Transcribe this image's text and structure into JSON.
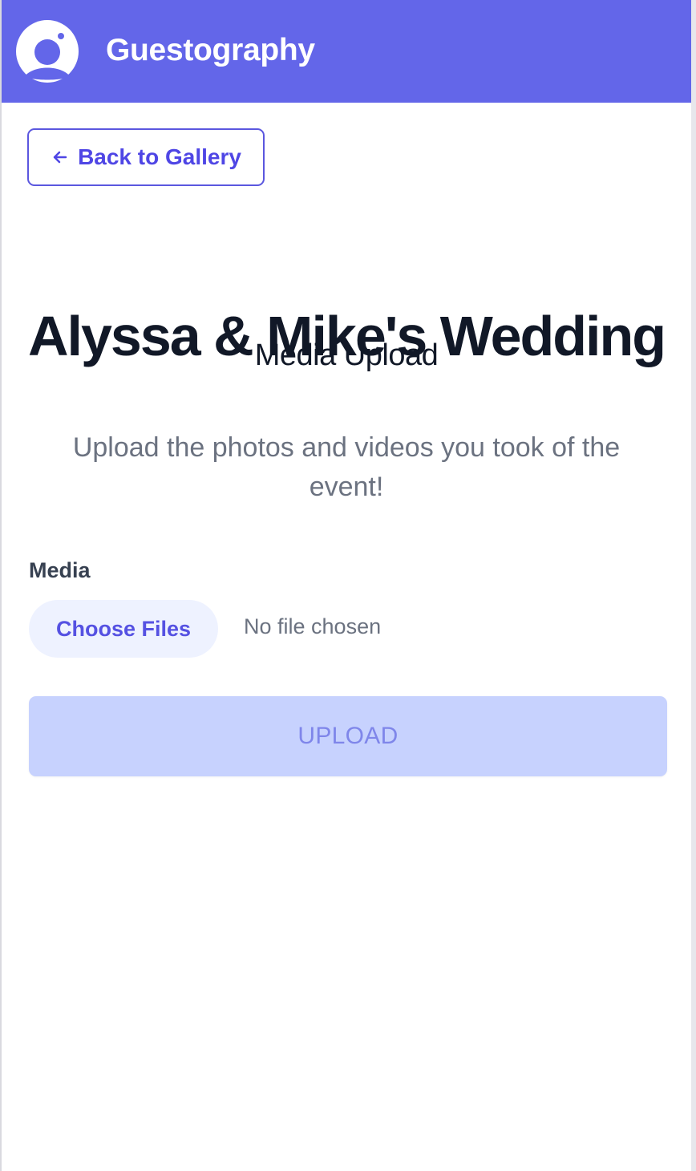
{
  "header": {
    "brand": "Guestography",
    "logo_icon": "camera-lens-icon",
    "background_color": "#6366e9"
  },
  "navigation": {
    "back_label": "Back to Gallery",
    "back_icon": "arrow-left-icon"
  },
  "event": {
    "title": "Alyssa & Mike's Wedding",
    "subtitle": "Media Upload",
    "description": "Upload the photos and videos you took of the event!"
  },
  "form": {
    "media_label": "Media",
    "choose_files_label": "Choose Files",
    "file_status": "No file chosen",
    "upload_label": "UPLOAD"
  },
  "colors": {
    "accent": "#4f46e5",
    "disabled_button": "#c7d2fe",
    "text_dark": "#111827",
    "text_muted": "#6b7280"
  }
}
